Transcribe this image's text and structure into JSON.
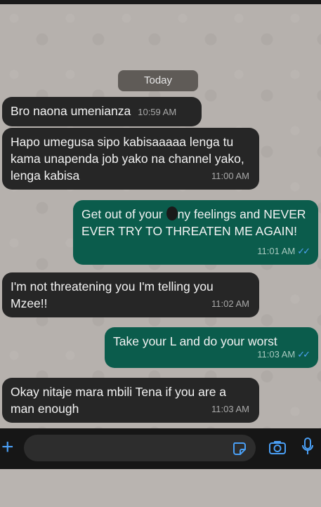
{
  "chat": {
    "date_label": "Today",
    "messages": [
      {
        "direction": "incoming",
        "text": "Bro naona umenianza",
        "time": "10:59 AM"
      },
      {
        "direction": "incoming",
        "text": "Hapo umegusa sipo kabisaaaaa lenga tu kama unapenda job yako na channel yako, lenga kabisa",
        "time": "11:00 AM"
      },
      {
        "direction": "outgoing",
        "text_before": "Get out of your ",
        "text_after": "ny feelings and NEVER EVER TRY TO THREATEN ME AGAIN!",
        "time": "11:01 AM",
        "read": "✓✓"
      },
      {
        "direction": "incoming",
        "text": "I'm not threatening you I'm telling you Mzee!!",
        "time": "11:02 AM"
      },
      {
        "direction": "outgoing",
        "text": "Take your L and do your worst",
        "time": "11:03 AM",
        "read": "✓✓"
      },
      {
        "direction": "incoming",
        "text": "Okay nitaje mara mbili Tena if you are a man enough",
        "time": "11:03 AM"
      }
    ]
  },
  "input_bar": {
    "plus_icon": "plus-icon",
    "sticker_icon": "sticker-icon",
    "camera_icon": "camera-icon",
    "mic_icon": "microphone-icon",
    "accent_color": "#4a9ff5"
  },
  "colors": {
    "incoming_bubble": "#262626",
    "outgoing_bubble": "#0b5c4c",
    "read_ticks": "#4fa3f7"
  }
}
